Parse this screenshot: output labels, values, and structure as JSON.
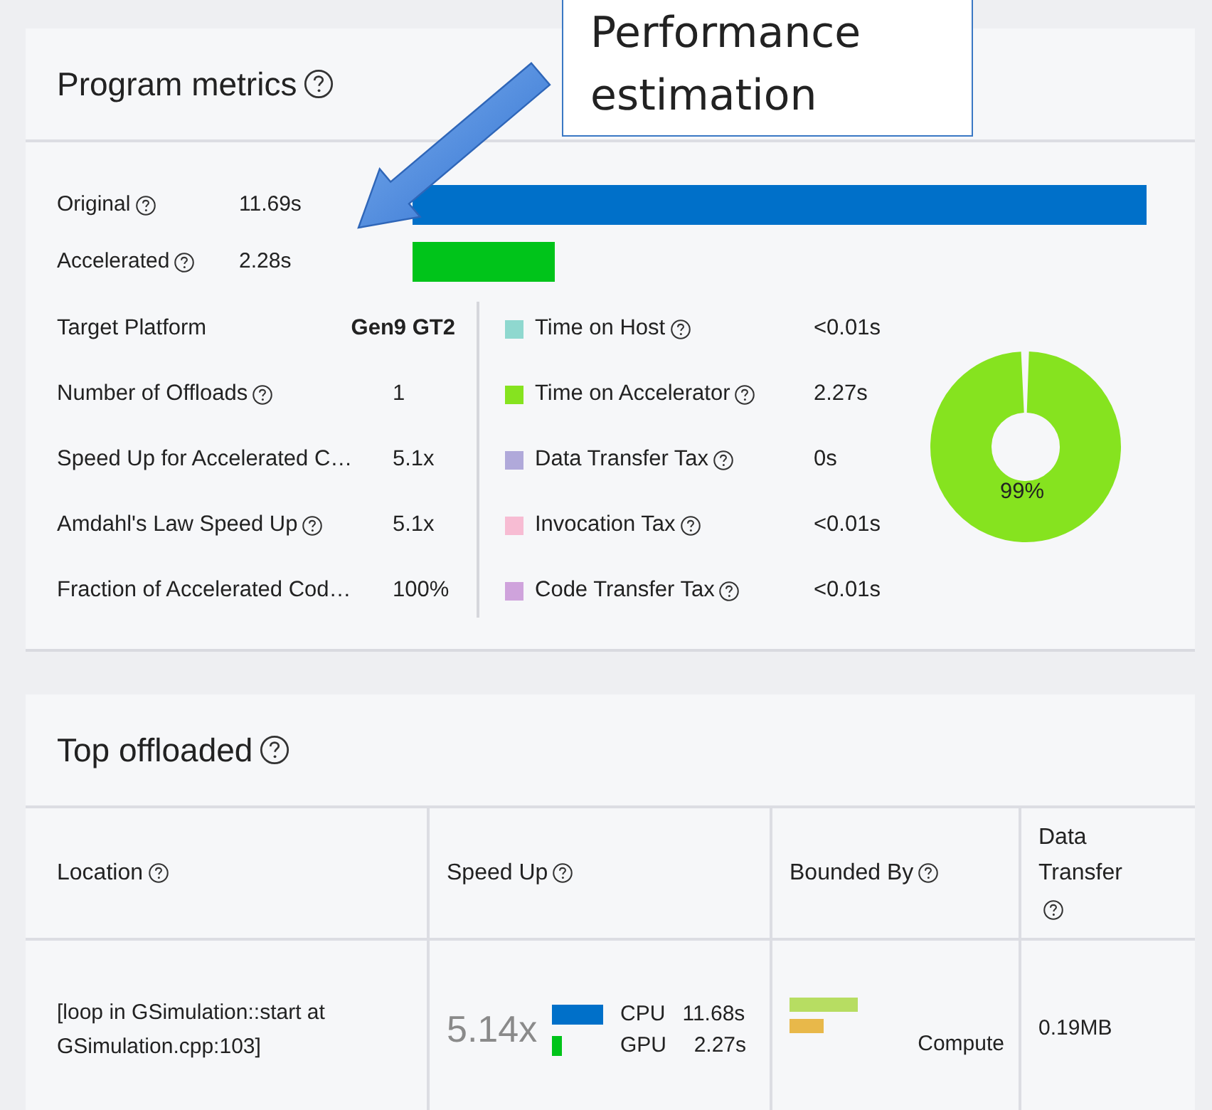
{
  "callout": {
    "text": "Performance estimation"
  },
  "program_metrics": {
    "title": "Program metrics",
    "timings": [
      {
        "label": "Original",
        "value": "11.69s",
        "color": "#0070c9"
      },
      {
        "label": "Accelerated",
        "value": "2.28s",
        "color": "#00c41a"
      }
    ],
    "stats": [
      {
        "label": "Target Platform",
        "help": false,
        "value": "Gen9 GT2",
        "bold": true
      },
      {
        "label": "Number of Offloads",
        "help": true,
        "value": "1",
        "bold": false
      },
      {
        "label": "Speed Up for Accelerated C…",
        "help": false,
        "value": "5.1x",
        "bold": false
      },
      {
        "label": "Amdahl's Law Speed Up",
        "help": true,
        "value": "5.1x",
        "bold": false
      },
      {
        "label": "Fraction of Accelerated Cod…",
        "help": false,
        "value": "100%",
        "bold": false
      }
    ],
    "breakdown": [
      {
        "label": "Time on Host",
        "value": "<0.01s",
        "color": "#8fd8cf"
      },
      {
        "label": "Time on Accelerator",
        "value": "2.27s",
        "color": "#86e31f"
      },
      {
        "label": "Data Transfer Tax",
        "value": "0s",
        "color": "#b0a9da"
      },
      {
        "label": "Invocation Tax",
        "value": "<0.01s",
        "color": "#f7bcd3"
      },
      {
        "label": "Code Transfer Tax",
        "value": "<0.01s",
        "color": "#cfa3dc"
      }
    ],
    "donut": {
      "level": 0.985,
      "label": "99%",
      "color": "#86e31f"
    }
  },
  "top_offloaded": {
    "title": "Top offloaded",
    "columns": [
      {
        "label": "Location"
      },
      {
        "label": "Speed Up"
      },
      {
        "label": "Bounded By"
      },
      {
        "label": "Data Transfer"
      }
    ],
    "rows": [
      {
        "location": "[loop in GSimulation::start at GSimulation.cpp:103]",
        "speedup": "5.14x",
        "cpu_label": "CPU",
        "cpu_time": "11.68s",
        "gpu_label": "GPU",
        "gpu_time": "2.27s",
        "bounded_by": "Compute",
        "data_transfer": "0.19MB"
      }
    ]
  }
}
